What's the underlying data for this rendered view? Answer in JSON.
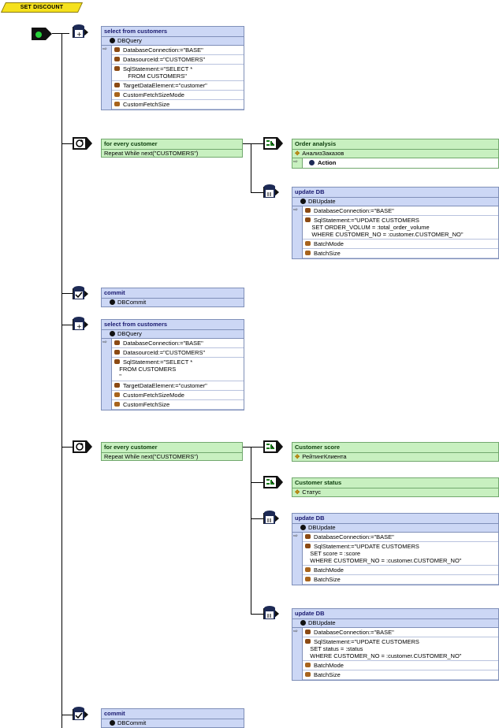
{
  "title": "SET DISCOUNT",
  "blocks": {
    "q1": {
      "title": "select from customers",
      "type": "DBQuery",
      "props": [
        "DatabaseConnection:=\"BASE\"",
        "DatasourceId:=\"CUSTOMERS\"",
        "SqlStatement:=\"SELECT *\n   FROM CUSTOMERS\"",
        "TargetDataElement:=\"customer\"",
        "CustomFetchSizeMode",
        "CustomFetchSize"
      ]
    },
    "loop1": {
      "title": "for every customer",
      "cond": "Repeat While next(\"CUSTOMERS\")"
    },
    "oa": {
      "title": "Order analysis",
      "sub": "АнализЗаказов",
      "action": "Action"
    },
    "u1": {
      "title": "update DB",
      "type": "DBUpdate",
      "props": [
        "DatabaseConnection:=\"BASE\"",
        "SqlStatement:=\"UPDATE CUSTOMERS\n    SET ORDER_VOLUM = :total_order_volume\n    WHERE CUSTOMER_NO = :customer.CUSTOMER_NO\"",
        "BatchMode",
        "BatchSize"
      ]
    },
    "c1": {
      "title": "commit",
      "type": "DBCommit"
    },
    "q2": {
      "title": "select from customers",
      "type": "DBQuery",
      "props": [
        "DatabaseConnection:=\"BASE\"",
        "DatasourceId:=\"CUSTOMERS\"",
        "SqlStatement:=\"SELECT *\n   FROM CUSTOMERS\n   \"",
        "TargetDataElement:=\"customer\"",
        "CustomFetchSizeMode",
        "CustomFetchSize"
      ]
    },
    "loop2": {
      "title": "for every customer",
      "cond": "Repeat While next(\"CUSTOMERS\")"
    },
    "cs": {
      "title": "Customer score",
      "sub": "РейтингКлиента"
    },
    "cst": {
      "title": "Customer status",
      "sub": "Статус"
    },
    "u2": {
      "title": "update DB",
      "type": "DBUpdate",
      "props": [
        "DatabaseConnection:=\"BASE\"",
        "SqlStatement:=\"UPDATE CUSTOMERS\n   SET score = :score\n   WHERE CUSTOMER_NO = :customer.CUSTOMER_NO\"",
        "BatchMode",
        "BatchSize"
      ]
    },
    "u3": {
      "title": "update DB",
      "type": "DBUpdate",
      "props": [
        "DatabaseConnection:=\"BASE\"",
        "SqlStatement:=\"UPDATE CUSTOMERS\n   SET status = :status\n   WHERE CUSTOMER_NO = :customer.CUSTOMER_NO\"",
        "BatchMode",
        "BatchSize"
      ]
    },
    "c2": {
      "title": "commit",
      "type": "DBCommit"
    }
  }
}
